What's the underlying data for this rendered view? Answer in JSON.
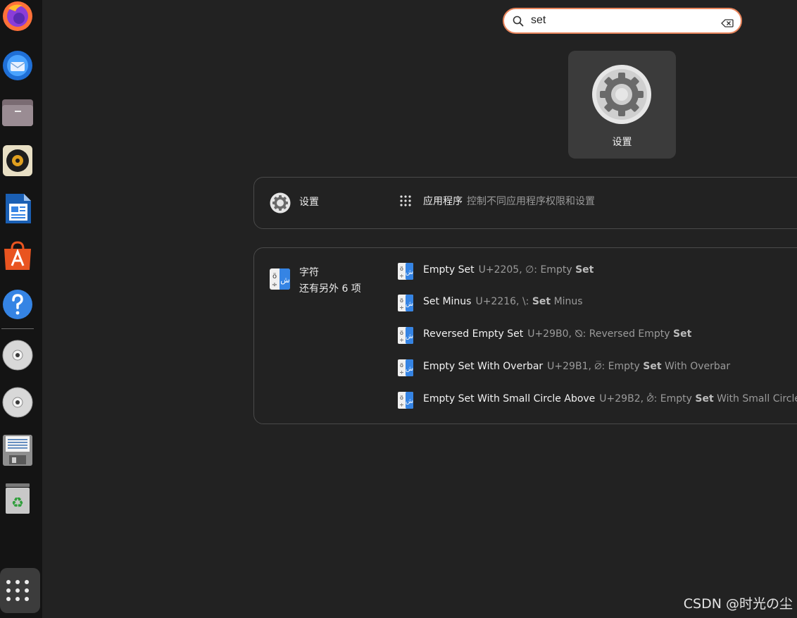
{
  "dock": {
    "apps": [
      {
        "icon": "firefox-icon"
      },
      {
        "icon": "thunderbird-icon"
      },
      {
        "icon": "files-icon"
      },
      {
        "icon": "rhythmbox-icon"
      },
      {
        "icon": "libreoffice-writer-icon"
      },
      {
        "icon": "app-center-icon"
      },
      {
        "icon": "help-icon"
      },
      {
        "icon": "disc-icon"
      },
      {
        "icon": "disc-icon"
      },
      {
        "icon": "floppy-drive-icon"
      },
      {
        "icon": "trash-icon"
      }
    ],
    "show_apps_icon": "app-grid-icon"
  },
  "search": {
    "value": "set",
    "accent": "#e9855c"
  },
  "app_result": {
    "label": "设置"
  },
  "settings_provider": {
    "name": "设置",
    "result": {
      "title": "应用程序",
      "description": "控制不同应用程序权限和设置"
    }
  },
  "characters_provider": {
    "name": "字符",
    "more": "还有另外 6 项",
    "results": [
      {
        "title": "Empty Set",
        "desc_pre": "U+2205, ∅: Empty ",
        "desc_bold": "Set",
        "desc_post": ""
      },
      {
        "title": "Set Minus",
        "desc_pre": "U+2216, \\: ",
        "desc_bold": "Set",
        "desc_post": " Minus"
      },
      {
        "title": "Reversed Empty Set",
        "desc_pre": "U+29B0, ⦰: Reversed Empty ",
        "desc_bold": "Set",
        "desc_post": ""
      },
      {
        "title": "Empty Set With Overbar",
        "desc_pre": "U+29B1, ⦱: Empty ",
        "desc_bold": "Set",
        "desc_post": " With Overbar"
      },
      {
        "title": "Empty Set With Small Circle Above",
        "desc_pre": "U+29B2, ⦲: Empty ",
        "desc_bold": "Set",
        "desc_post": " With Small Circle Above"
      }
    ]
  },
  "watermark": "CSDN @时光の尘"
}
